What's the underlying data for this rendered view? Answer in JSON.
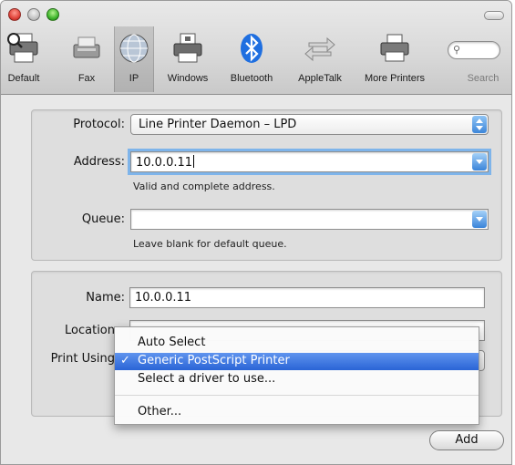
{
  "toolbar": {
    "items": [
      {
        "label": "Default",
        "icon": "printer-icon"
      },
      {
        "label": "Fax",
        "icon": "fax-icon"
      },
      {
        "label": "IP",
        "icon": "globe-icon",
        "selected": true
      },
      {
        "label": "Windows",
        "icon": "windows-printer-icon"
      },
      {
        "label": "Bluetooth",
        "icon": "bluetooth-icon"
      },
      {
        "label": "AppleTalk",
        "icon": "appletalk-icon"
      },
      {
        "label": "More Printers",
        "icon": "more-printers-icon"
      }
    ],
    "search_label": "Search",
    "search_value": "",
    "search_icon": "search-icon"
  },
  "ip_group": {
    "protocol_label": "Protocol:",
    "protocol_value": "Line Printer Daemon – LPD",
    "address_label": "Address:",
    "address_value": "10.0.0.11",
    "address_hint": "Valid and complete address.",
    "queue_label": "Queue:",
    "queue_value": "",
    "queue_hint": "Leave blank for default queue."
  },
  "printer_group": {
    "name_label": "Name:",
    "name_value": "10.0.0.11",
    "location_label": "Location",
    "location_value": "",
    "print_using_label": "Print Using"
  },
  "dropdown": {
    "items": [
      "Auto Select",
      "Generic PostScript Printer",
      "Select a driver to use...",
      "Other..."
    ],
    "selected_index": 1,
    "check_mark": "✓"
  },
  "footer": {
    "add_label": "Add"
  },
  "colors": {
    "selection": "#2a64d6",
    "focus_ring": "#7eb4ea"
  }
}
